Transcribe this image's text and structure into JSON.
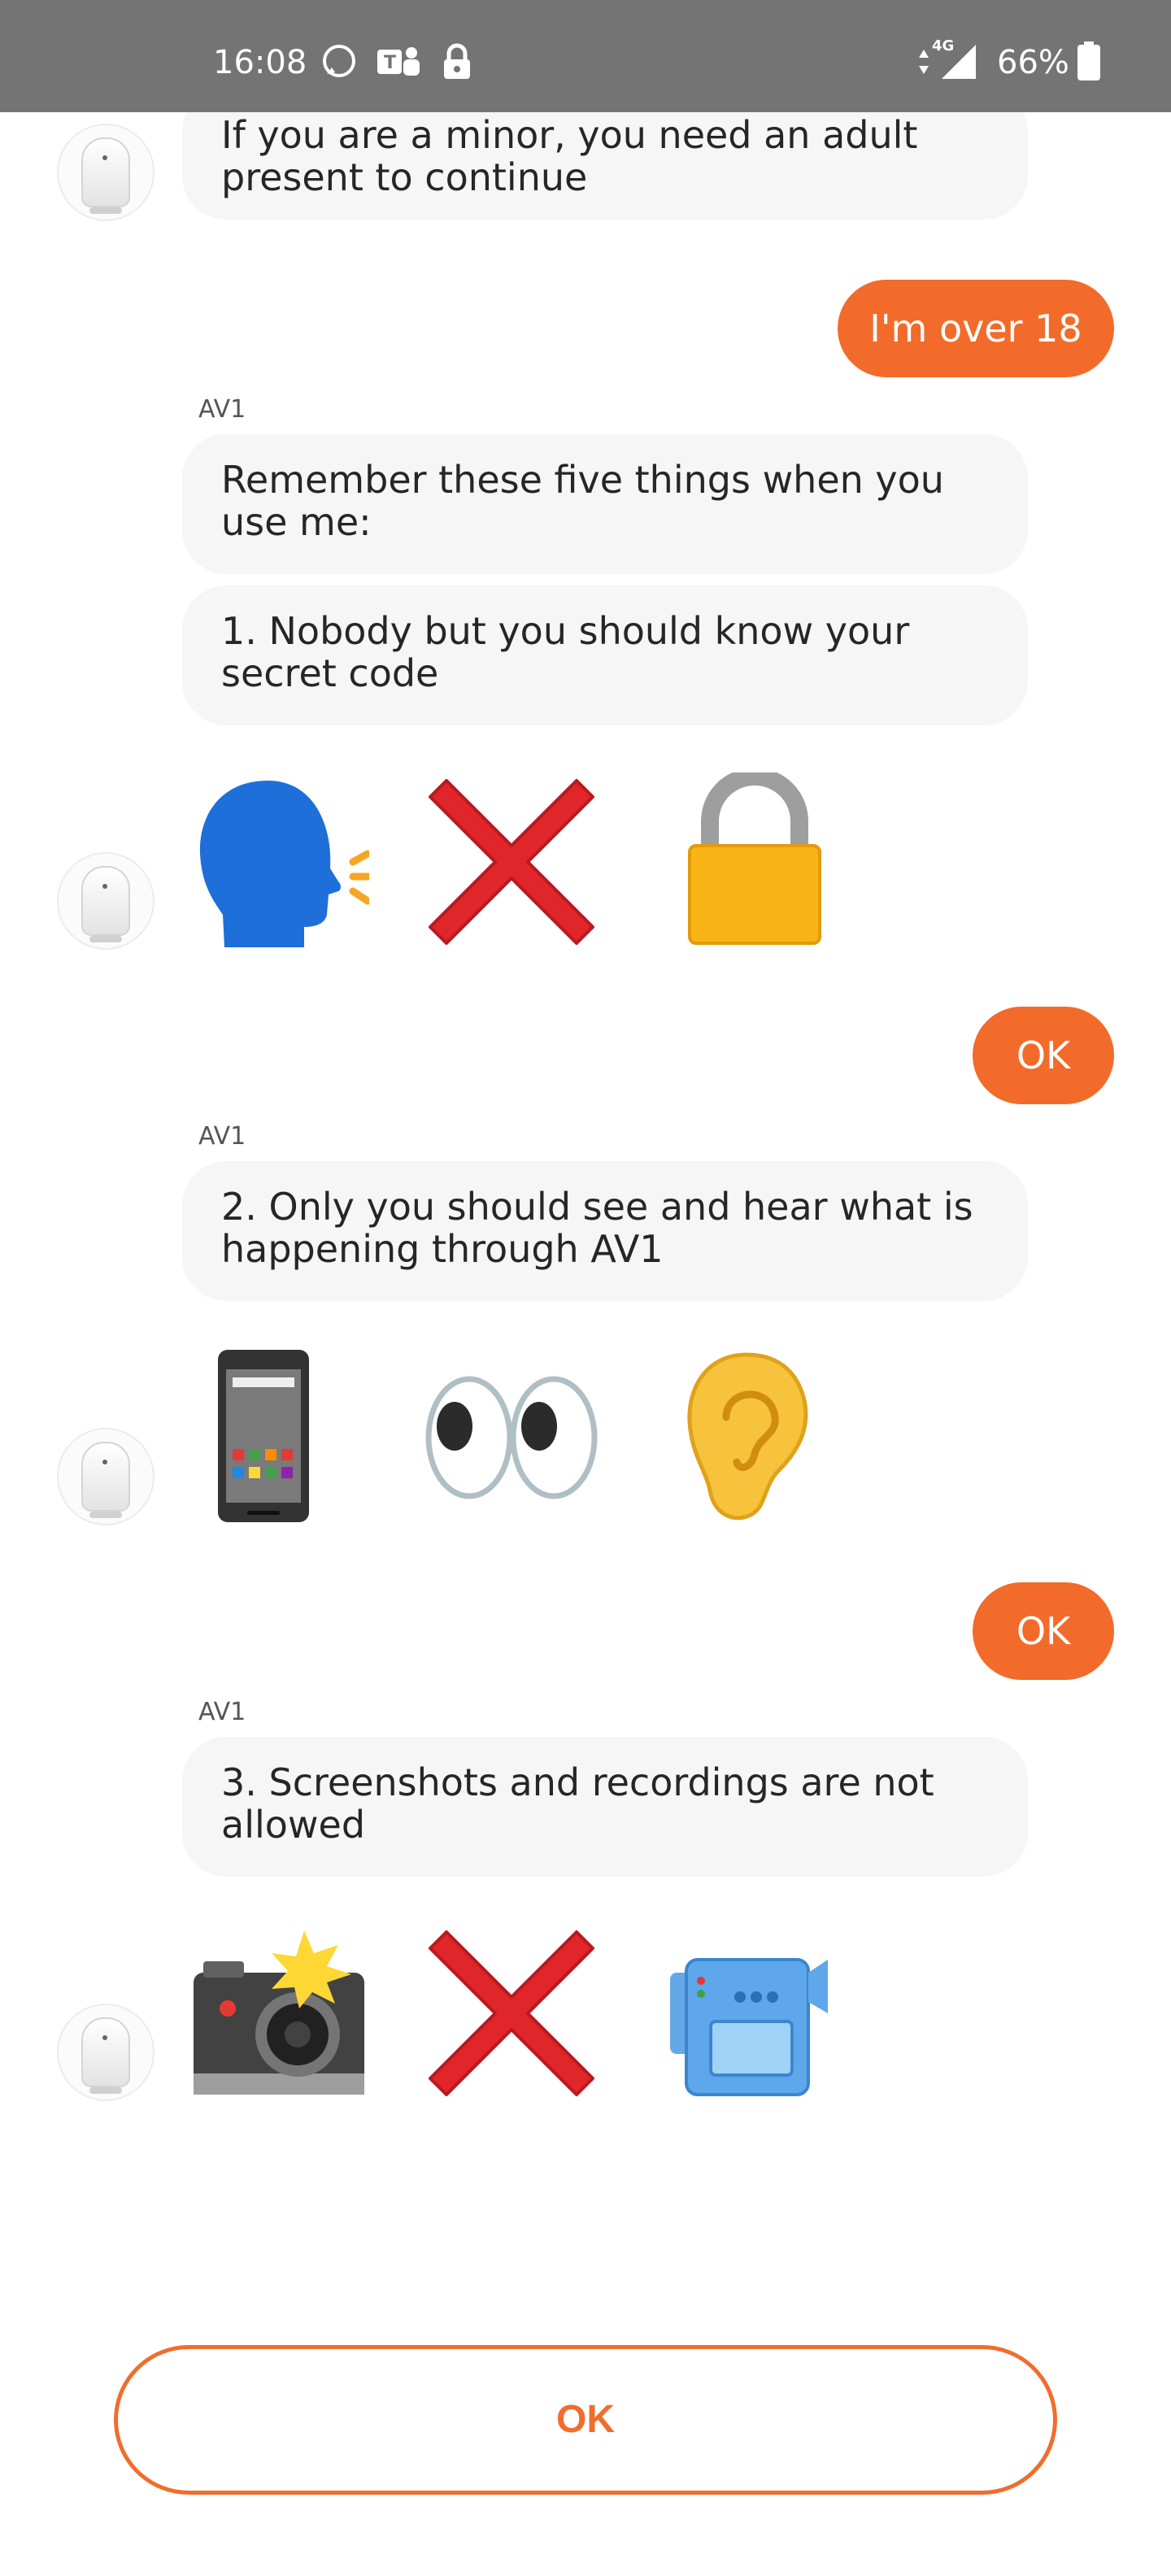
{
  "status_bar": {
    "time": "16:08",
    "network": "4G",
    "battery": "66%",
    "icons": [
      "chat-bubble-icon",
      "teams-icon",
      "lock-icon",
      "data-arrows-icon",
      "signal-icon",
      "battery-icon"
    ]
  },
  "colors": {
    "accent": "#f26b2a",
    "bubble_bg": "#f6f6f6",
    "status_bar_bg": "#747474"
  },
  "chat": {
    "messages": [
      {
        "from": "bot",
        "text": "If you are a minor, you need an adult present to continue"
      },
      {
        "from": "user",
        "text": "I'm over 18"
      },
      {
        "from": "bot",
        "sender": "AV1",
        "texts": [
          "Remember these five things when you use me:",
          "1. Nobody but you should know your secret code"
        ],
        "emojis": [
          "speaking-head-icon",
          "cross-mark-icon",
          "padlock-icon"
        ]
      },
      {
        "from": "user",
        "text": "OK"
      },
      {
        "from": "bot",
        "sender": "AV1",
        "texts": [
          "2. Only you should see and hear what is happening through AV1"
        ],
        "emojis": [
          "mobile-phone-icon",
          "eyes-icon",
          "ear-icon"
        ]
      },
      {
        "from": "user",
        "text": "OK"
      },
      {
        "from": "bot",
        "sender": "AV1",
        "texts": [
          "3. Screenshots and recordings are not allowed"
        ],
        "emojis": [
          "camera-with-flash-icon",
          "cross-mark-icon",
          "video-camera-icon"
        ]
      }
    ]
  },
  "footer": {
    "ok_button": "OK"
  }
}
